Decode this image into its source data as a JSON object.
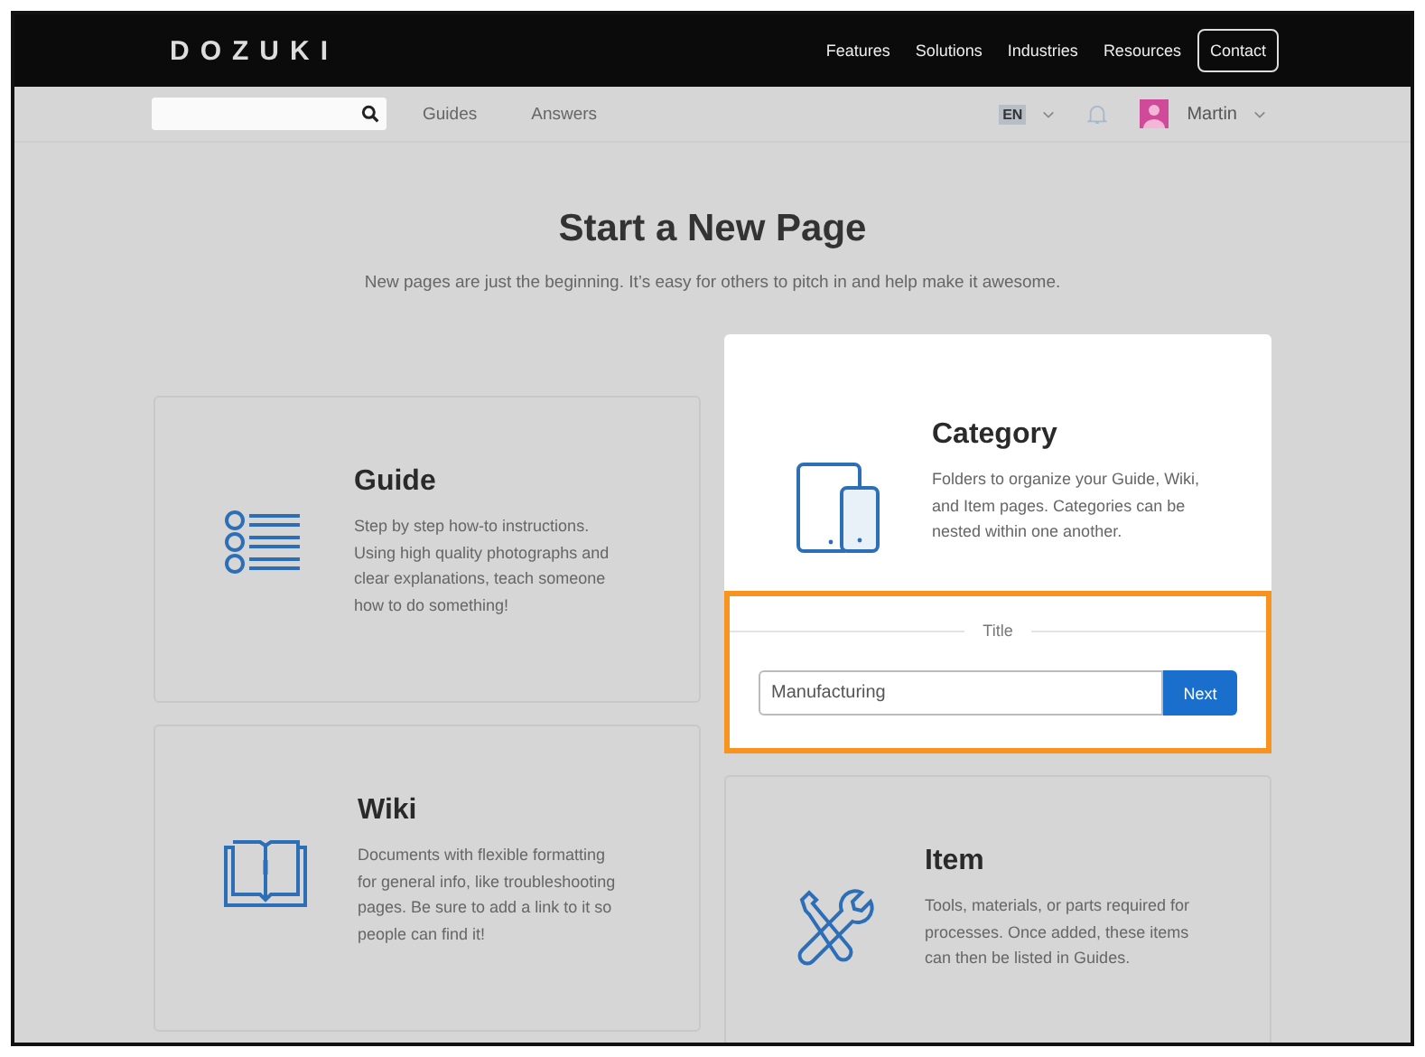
{
  "header": {
    "logo": "DOZUKI",
    "nav": [
      {
        "label": "Features",
        "kind": "link"
      },
      {
        "label": "Solutions",
        "kind": "link"
      },
      {
        "label": "Industries",
        "kind": "link"
      },
      {
        "label": "Resources",
        "kind": "link"
      },
      {
        "label": "Contact",
        "kind": "outlined"
      }
    ]
  },
  "subnav": {
    "links": [
      "Guides",
      "Answers"
    ],
    "language": "EN",
    "user": "Martin"
  },
  "page": {
    "title": "Start a New Page",
    "subtitle": "New pages are just the beginning. It’s easy for others to pitch in and help make it awesome."
  },
  "cards": [
    {
      "title": "Guide",
      "kind": "list",
      "selected": false,
      "text": "Step by step how-to instructions. Using high quality photographs and clear explanations, teach someone how to do something!"
    },
    {
      "title": "Category",
      "kind": "devices",
      "selected": true,
      "text": "Folders to organize your Guide, Wiki, and Item pages. Categories can be nested within one another.",
      "form": {
        "label": "Title",
        "value": "Manufacturing",
        "button": "Next",
        "highlighted": true
      }
    },
    {
      "title": "Wiki",
      "kind": "book",
      "selected": false,
      "text": "Documents with flexible formatting for general info, like troubleshooting pages. Be sure to add a link to it so people can find it!"
    },
    {
      "title": "Item",
      "kind": "tools",
      "selected": false,
      "text": "Tools, materials, or parts required for processes. Once added, these items can then be listed in Guides."
    }
  ]
}
